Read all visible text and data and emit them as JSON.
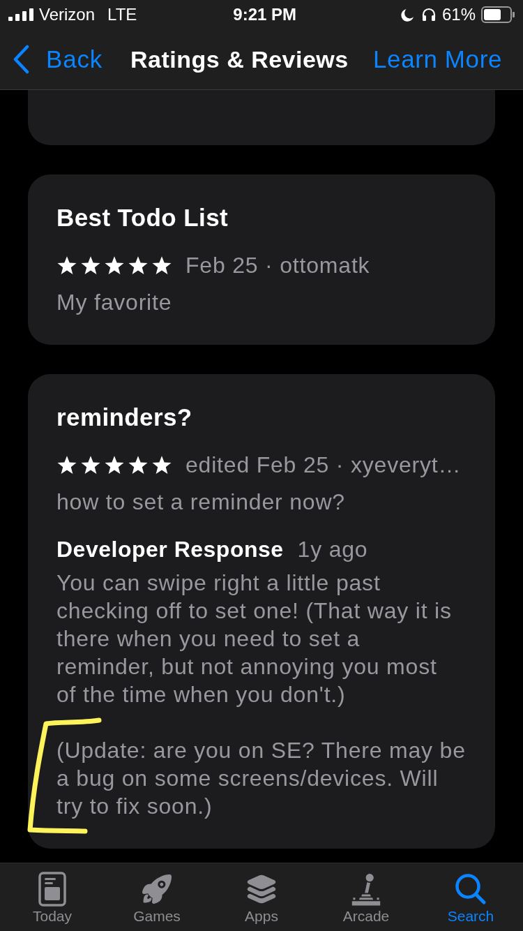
{
  "status_bar": {
    "carrier": "Verizon",
    "network": "LTE",
    "time": "9:21 PM",
    "battery": "61%"
  },
  "nav_bar": {
    "back": "Back",
    "title": "Ratings & Reviews",
    "action": "Learn More"
  },
  "reviews": [
    {
      "title": "Best Todo List",
      "stars": 5,
      "meta": "Feb 25 · ottomatk",
      "body": "My favorite"
    },
    {
      "title": "reminders?",
      "stars": 5,
      "meta": "edited Feb 25 · xyeveryt…",
      "body": "how to set a reminder now?",
      "developer_response": {
        "label": "Developer Response",
        "age": "1y ago",
        "paragraphs": [
          "You can swipe right a little past checking off to set one! (That way it is there when you need to set a reminder, but not annoying you most of the time when you don't.)",
          "(Update: are you on SE? There may be a bug on some screens/devices. Will try to fix soon.)"
        ]
      }
    }
  ],
  "tab_bar": [
    {
      "label": "Today",
      "selected": false
    },
    {
      "label": "Games",
      "selected": false
    },
    {
      "label": "Apps",
      "selected": false
    },
    {
      "label": "Arcade",
      "selected": false
    },
    {
      "label": "Search",
      "selected": true
    }
  ]
}
